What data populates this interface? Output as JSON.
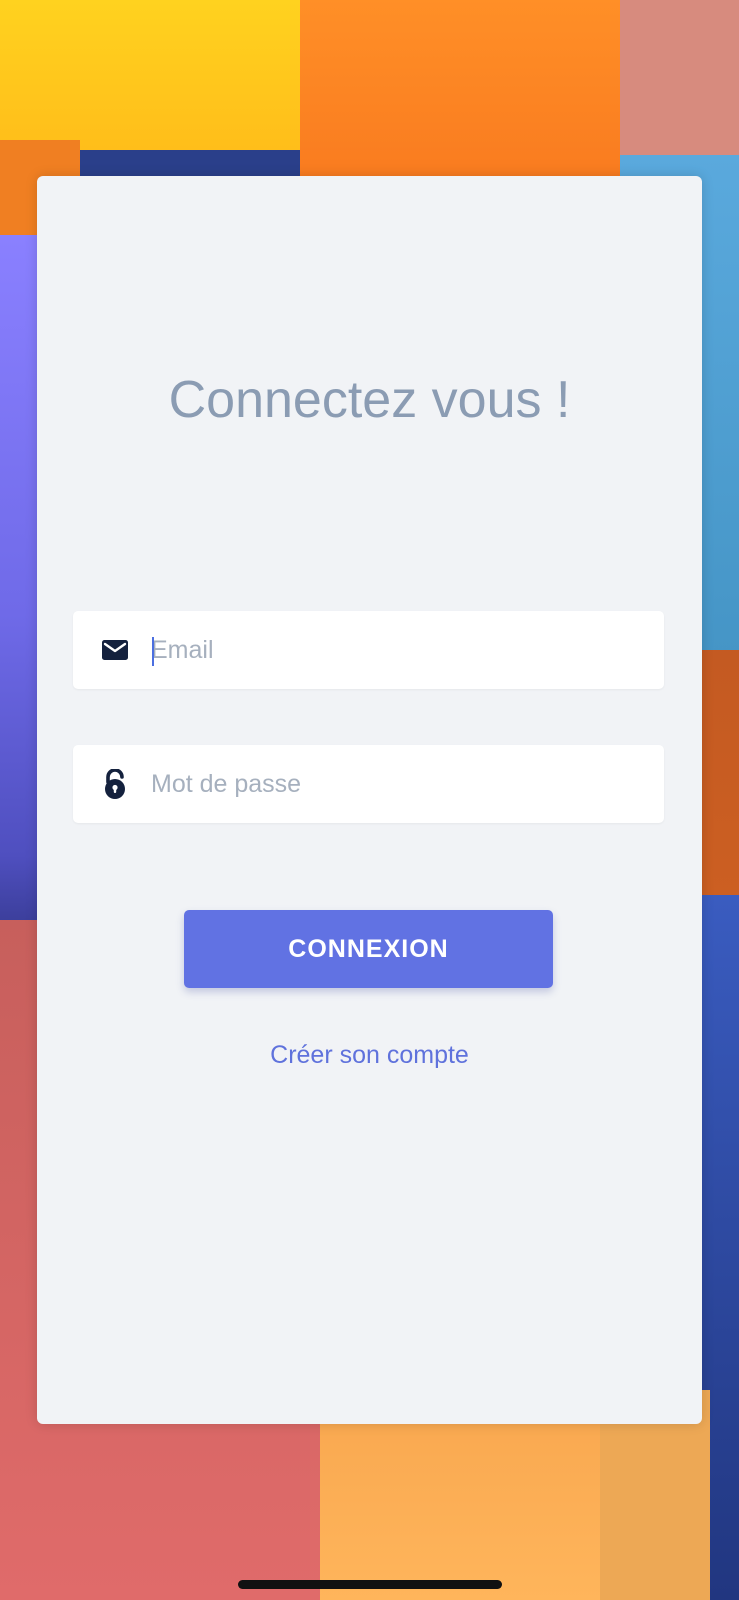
{
  "login": {
    "title": "Connectez vous !",
    "email": {
      "placeholder": "Email",
      "value": "",
      "icon": "mail-icon"
    },
    "password": {
      "placeholder": "Mot de passe",
      "value": "",
      "icon": "lock-open-icon"
    },
    "submit_label": "CONNEXION",
    "create_account_label": "Créer son compte"
  },
  "colors": {
    "card_background": "#f1f3f6",
    "title": "#8b9cb3",
    "primary": "#6172e3",
    "link": "#5f72dc",
    "icon": "#14213d"
  }
}
